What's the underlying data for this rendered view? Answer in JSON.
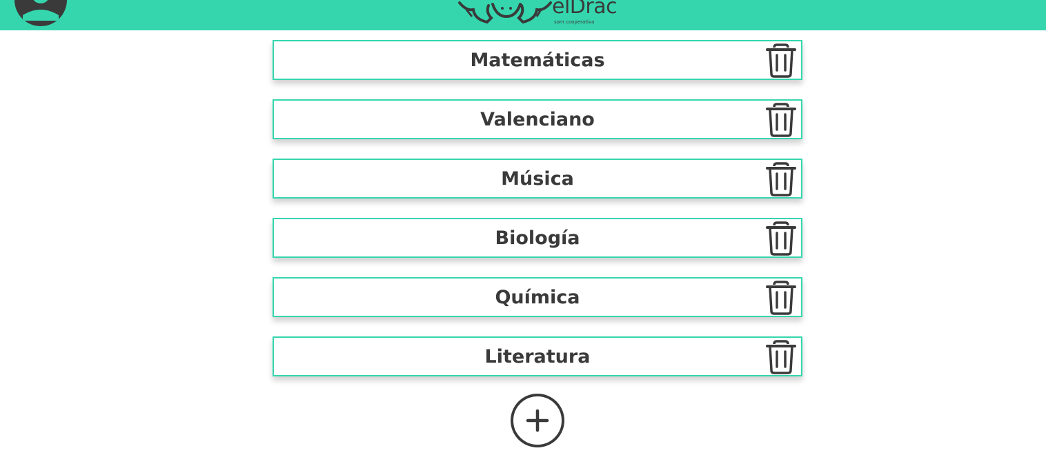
{
  "header": {
    "brand_name": "elDrac",
    "brand_tagline": "som cooperativa",
    "accent_color": "#35d6ae",
    "avatar_icon": "user-avatar-icon"
  },
  "subjects": [
    {
      "label": "Matemáticas",
      "delete_icon": "trash-icon"
    },
    {
      "label": "Valenciano",
      "delete_icon": "trash-icon"
    },
    {
      "label": "Música",
      "delete_icon": "trash-icon"
    },
    {
      "label": "Biología",
      "delete_icon": "trash-icon"
    },
    {
      "label": "Química",
      "delete_icon": "trash-icon"
    },
    {
      "label": "Literatura",
      "delete_icon": "trash-icon"
    }
  ],
  "add_button": {
    "icon": "plus-circle-icon"
  },
  "colors": {
    "text": "#3a3a3a",
    "border": "#35d6ae",
    "background": "#ffffff"
  }
}
